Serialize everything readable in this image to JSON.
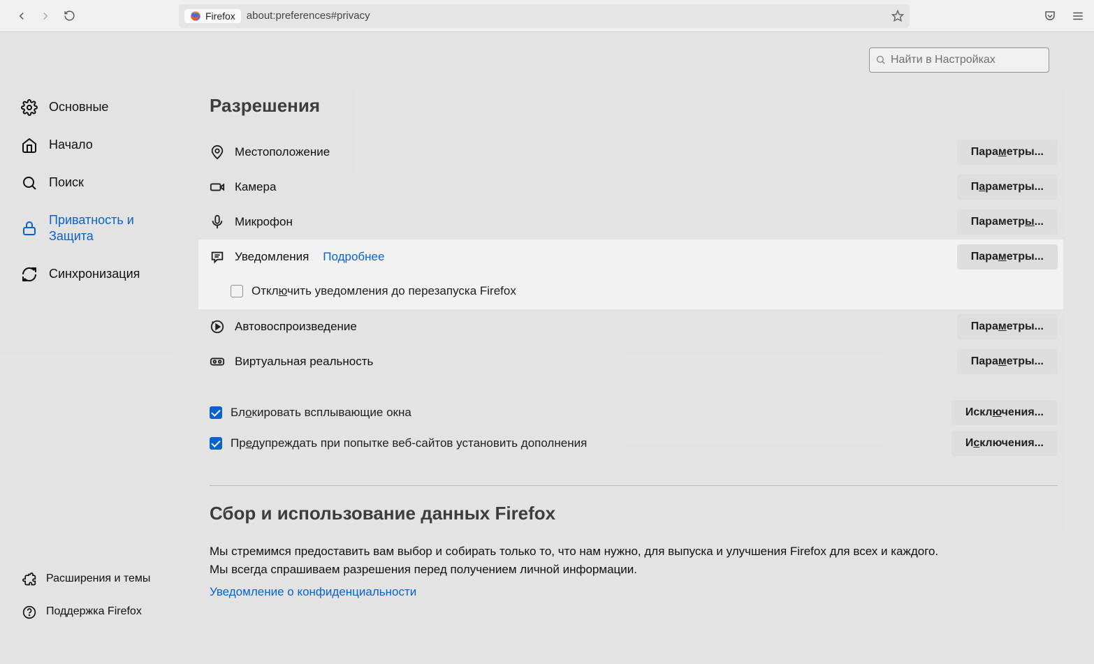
{
  "navbar": {
    "origin_label": "Firefox",
    "url": "about:preferences#privacy"
  },
  "search": {
    "placeholder": "Найти в Настройках"
  },
  "sidebar": {
    "items": [
      {
        "label": "Основные"
      },
      {
        "label": "Начало"
      },
      {
        "label": "Поиск"
      },
      {
        "label_a": "Приватность и",
        "label_b": "Защита"
      },
      {
        "label": "Синхронизация"
      }
    ],
    "bottom": [
      {
        "label": "Расширения и темы"
      },
      {
        "label": "Поддержка Firefox"
      }
    ]
  },
  "perm": {
    "title": "Разрешения",
    "items": {
      "location": "Местоположение",
      "camera": "Камера",
      "microphone": "Микрофон",
      "notifications": "Уведомления",
      "more": "Подробнее",
      "pause_notif_a": "Откл",
      "pause_notif_u": "ю",
      "pause_notif_b": "чить уведомления до перезапуска Firefox",
      "autoplay": "Автовоспроизведение",
      "vr": "Виртуальная реальность",
      "popups_a": "Бл",
      "popups_u": "о",
      "popups_b": "кировать всплывающие окна",
      "addons_a": "Пр",
      "addons_u": "е",
      "addons_b": "дупреждать при попытке веб-сайтов установить дополнения"
    },
    "btn": {
      "params_pre": "Пара",
      "params_u": "м",
      "params_post": "етры...",
      "params2_pre": "П",
      "params2_u": "а",
      "params2_post": "раметры...",
      "params3_pre": "Параметр",
      "params3_u": "ы",
      "params3_post": "...",
      "excl_pre": "Искл",
      "excl_u": "ю",
      "excl_post": "чения...",
      "excl2_pre": "И",
      "excl2_u": "с",
      "excl2_post": "ключения..."
    }
  },
  "data": {
    "title": "Сбор и использование данных Firefox",
    "p1": "Мы стремимся предоставить вам выбор и собирать только то, что нам нужно, для выпуска и улучшения Firefox для всех и каждого.",
    "p2": "Мы всегда спрашиваем разрешения перед получением личной информации.",
    "link": "Уведомление о конфиденциальности"
  }
}
